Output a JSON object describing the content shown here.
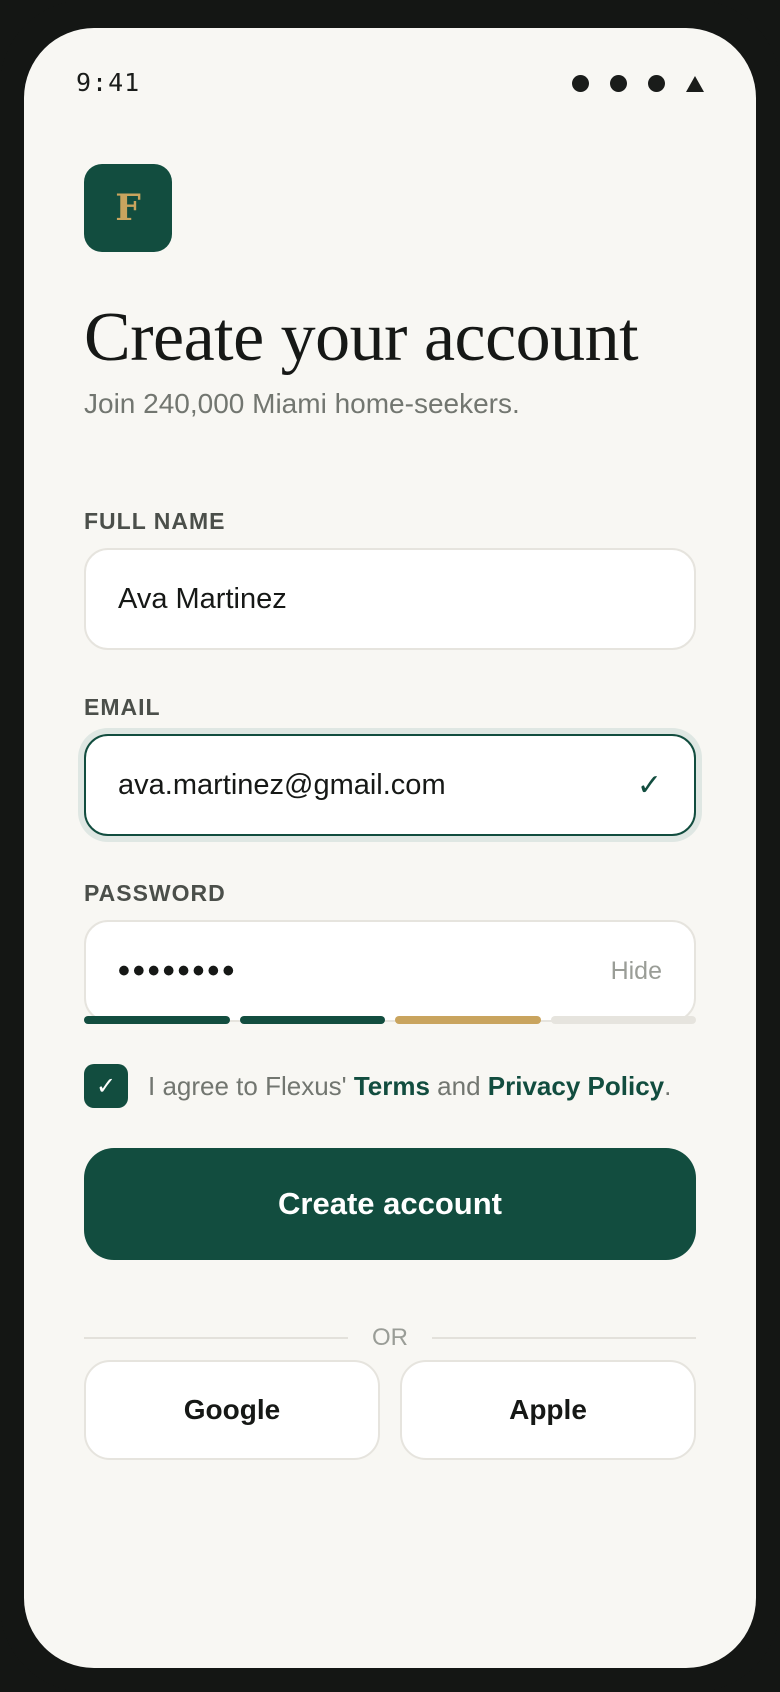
{
  "status_bar": {
    "time": "9:41",
    "icons": [
      "signal-dot-icon",
      "signal-dot-icon",
      "signal-dot-icon",
      "network-triangle-icon"
    ]
  },
  "brand": {
    "logo_letter": "F",
    "logo_bg": "#124d3f",
    "logo_fg": "#c9a45e"
  },
  "header": {
    "title": "Create your account",
    "subtitle": "Join 240,000 Miami home-seekers."
  },
  "form": {
    "full_name": {
      "label": "FULL NAME",
      "value": "Ava Martinez"
    },
    "email": {
      "label": "EMAIL",
      "value": "ava.martinez@gmail.com",
      "valid_icon": "check-icon",
      "valid_mark": "✓"
    },
    "password": {
      "label": "PASSWORD",
      "masked_value": "••••••••",
      "toggle_label": "Hide"
    },
    "strength": {
      "segments_total": 4,
      "segments_filled": 3,
      "colors": [
        "#124d3f",
        "#124d3f",
        "#c9a45e",
        "#e6e4de"
      ]
    },
    "terms": {
      "checked": true,
      "check_mark": "✓",
      "prefix": "I agree to Flexus' ",
      "terms_link": "Terms",
      "middle": " and ",
      "privacy_link": "Privacy Policy",
      "suffix": "."
    },
    "submit_label": "Create account"
  },
  "divider": {
    "label": "OR"
  },
  "social": {
    "google_label": "Google",
    "apple_label": "Apple"
  },
  "colors": {
    "accent": "#124d3f",
    "gold": "#c9a45e",
    "background": "#f8f7f3"
  }
}
